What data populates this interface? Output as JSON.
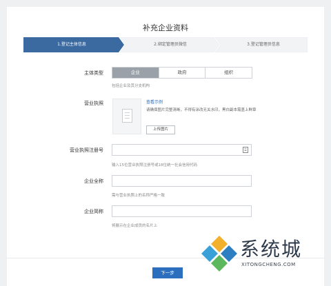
{
  "page_title": "补充企业资料",
  "steps": [
    {
      "label": "1.登记主体信息",
      "active": true
    },
    {
      "label": "2.绑定管理员微信",
      "active": false
    },
    {
      "label": "3.登记管理员信息",
      "active": false
    }
  ],
  "subject_type": {
    "label": "主体类型",
    "options": [
      "企业",
      "政府",
      "组织"
    ],
    "selected": "企业",
    "hint": "包括企业及其分支机构"
  },
  "license": {
    "label": "营业执照",
    "example_link": "查看示例",
    "description": "请确保图片完整清晰，不得有涂改无关水印，黑白副本需盖上鲜章",
    "upload_button": "上传图片"
  },
  "license_number": {
    "label": "营业执照注册号",
    "value": "",
    "placeholder": "",
    "hint": "输入15位营业执照注册号或18位统一社会信用代码"
  },
  "full_name": {
    "label": "企业全称",
    "value": "",
    "placeholder": "",
    "hint": "需与营业执照上的名称严格一致"
  },
  "short_name": {
    "label": "企业简称",
    "value": "",
    "placeholder": "",
    "hint": "将展示在企业成员的名片上"
  },
  "next_button": "下一步",
  "watermark": {
    "text_cn": "系统城",
    "text_en": "XITONGCHENG.COM"
  },
  "colors": {
    "step_active": "#3b6aa0",
    "step_inactive": "#f2f3f5",
    "segment_active": "#9aa1a8",
    "link": "#2f6db5",
    "primary_button": "#2c6fbe"
  }
}
